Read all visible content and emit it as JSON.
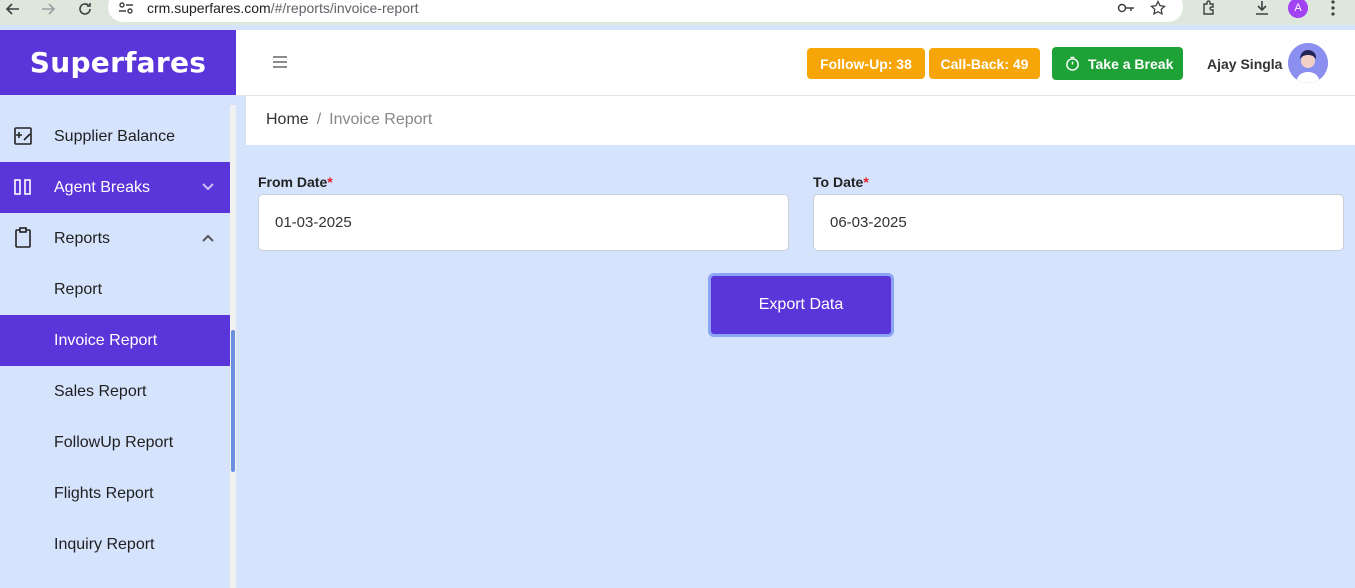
{
  "browser": {
    "url_host": "crm.superfares.com",
    "url_path": "/#/reports/invoice-report",
    "profile_initial": "A",
    "icons": [
      "back-arrow-icon",
      "forward-arrow-icon",
      "reload-icon",
      "site-settings-icon",
      "password-key-icon",
      "bookmark-star-icon",
      "extensions-icon",
      "download-icon",
      "more-menu-icon"
    ]
  },
  "app": {
    "logo": "Superfares",
    "brand_color": "#5a36da"
  },
  "sidebar": {
    "items": [
      {
        "label": "Supplier Balance",
        "icon": "supplier-balance-icon"
      },
      {
        "label": "Agent Breaks",
        "icon": "agent-breaks-icon",
        "chevron": "down"
      },
      {
        "label": "Reports",
        "icon": "clipboard-icon",
        "chevron": "up"
      },
      {
        "label": "Report"
      },
      {
        "label": "Invoice Report",
        "active": true
      },
      {
        "label": "Sales Report"
      },
      {
        "label": "FollowUp Report"
      },
      {
        "label": "Flights Report"
      },
      {
        "label": "Inquiry Report"
      }
    ]
  },
  "header": {
    "followup_label": "Follow-Up: 38",
    "callback_label": "Call-Back: 49",
    "break_label": "Take a Break",
    "user_name": "Ajay Singla",
    "badge_color": "#f6a609",
    "break_color": "#1ea137"
  },
  "breadcrumb": {
    "home": "Home",
    "separator": "/",
    "current": "Invoice Report"
  },
  "form": {
    "from_label": "From Date",
    "to_label": "To Date",
    "required_mark": "*",
    "from_value": "01-03-2025",
    "to_value": "06-03-2025",
    "export_label": "Export Data"
  }
}
